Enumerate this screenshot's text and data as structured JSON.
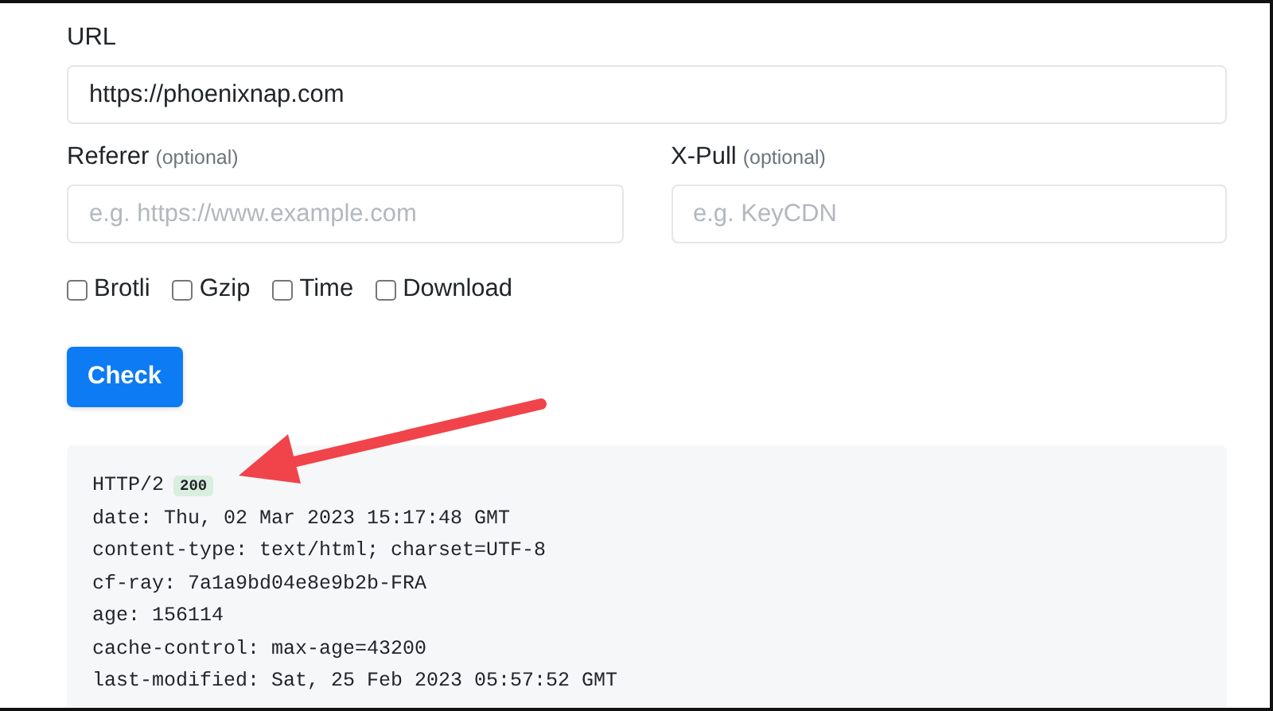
{
  "url_field": {
    "label": "URL",
    "value": "https://phoenixnap.com"
  },
  "optional_fields": [
    {
      "label": "Referer",
      "note": "(optional)",
      "placeholder": "e.g. https://www.example.com"
    },
    {
      "label": "X-Pull",
      "note": "(optional)",
      "placeholder": "e.g. KeyCDN"
    }
  ],
  "options": [
    {
      "label": "Brotli",
      "checked": false
    },
    {
      "label": "Gzip",
      "checked": false
    },
    {
      "label": "Time",
      "checked": false
    },
    {
      "label": "Download",
      "checked": false
    }
  ],
  "check_button": "Check",
  "response": {
    "protocol": "HTTP/2",
    "status_code": "200",
    "headers": [
      "date: Thu, 02 Mar 2023 15:17:48 GMT",
      "content-type: text/html; charset=UTF-8",
      "cf-ray: 7a1a9bd04e8e9b2b-FRA",
      "age: 156114",
      "cache-control: max-age=43200",
      "last-modified: Sat, 25 Feb 2023 05:57:52 GMT"
    ]
  }
}
